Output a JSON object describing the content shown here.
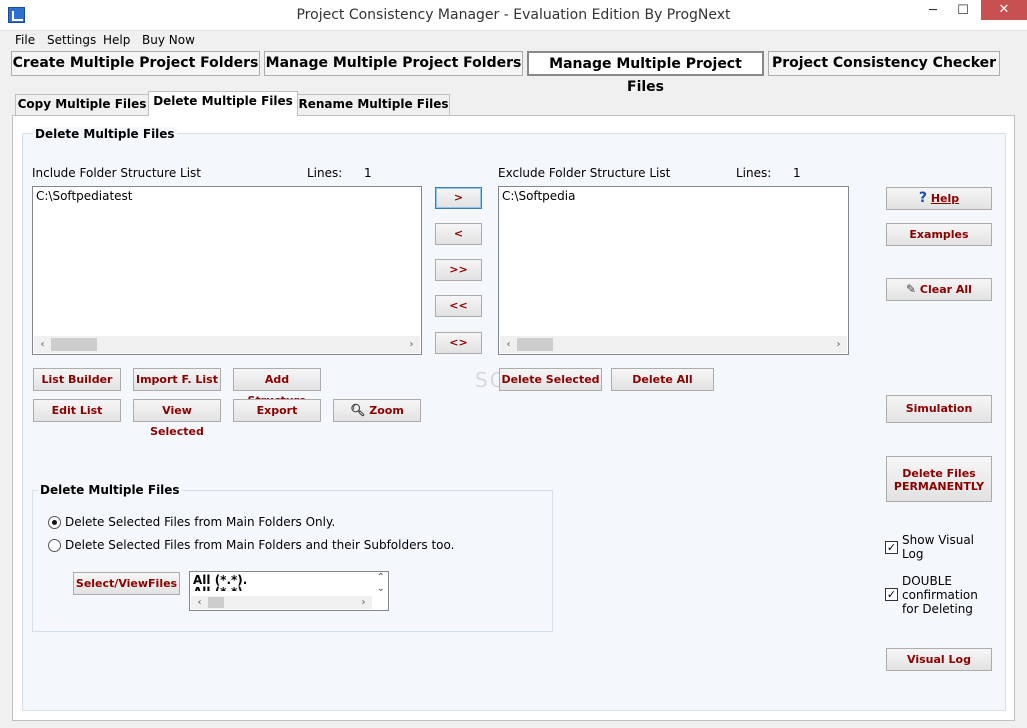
{
  "window": {
    "title": "Project Consistency Manager - Evaluation Edition  By ProgNext",
    "minimize": "─",
    "maximize": "☐",
    "close": "✕"
  },
  "menu": [
    "File",
    "Settings",
    "Help",
    "Buy Now"
  ],
  "main_tabs": [
    "Create Multiple Project Folders",
    "Manage Multiple Project Folders",
    "Manage Multiple Project Files",
    "Project Consistency Checker"
  ],
  "sub_tabs": [
    "Copy Multiple Files",
    "Delete Multiple Files",
    "Rename Multiple Files"
  ],
  "group_title": "Delete Multiple Files",
  "include": {
    "label": "Include Folder Structure List",
    "lines_label": "Lines:",
    "lines_value": "1",
    "items": [
      "C:\\Softpediatest"
    ]
  },
  "exclude": {
    "label": "Exclude Folder Structure List",
    "lines_label": "Lines:",
    "lines_value": "1",
    "items": [
      "C:\\Softpedia"
    ]
  },
  "transfer_buttons": [
    ">",
    "<",
    ">>",
    "<<",
    "<>"
  ],
  "include_buttons": {
    "list_builder": "List Builder",
    "import_list": "Import F. List",
    "add_structure": "Add Structure",
    "edit_list": "Edit List",
    "view_selected": "View Selected",
    "export": "Export",
    "zoom": "Zoom"
  },
  "exclude_buttons": {
    "delete_selected": "Delete Selected",
    "delete_all": "Delete All"
  },
  "side_buttons": {
    "help": "Help",
    "examples": "Examples",
    "clear_all": "Clear All",
    "simulation": "Simulation",
    "delete_permanently_line1": "Delete Files",
    "delete_permanently_line2": "PERMANENTLY",
    "visual_log": "Visual Log"
  },
  "checkboxes": {
    "show_visual_log_1": "Show Visual",
    "show_visual_log_2": "Log",
    "double_confirm_1": "DOUBLE",
    "double_confirm_2": "confirmation",
    "double_confirm_3": "for Deleting"
  },
  "delete_group": {
    "title": "Delete Multiple Files",
    "option1": "Delete Selected Files from Main Folders Only.",
    "option2": "Delete Selected Files from Main Folders and their Subfolders too.",
    "select_view_button": "Select/ViewFiles",
    "filter_items": [
      "All (*.*).",
      "All (*.*)"
    ]
  },
  "watermark": "SOFTPEDIA"
}
